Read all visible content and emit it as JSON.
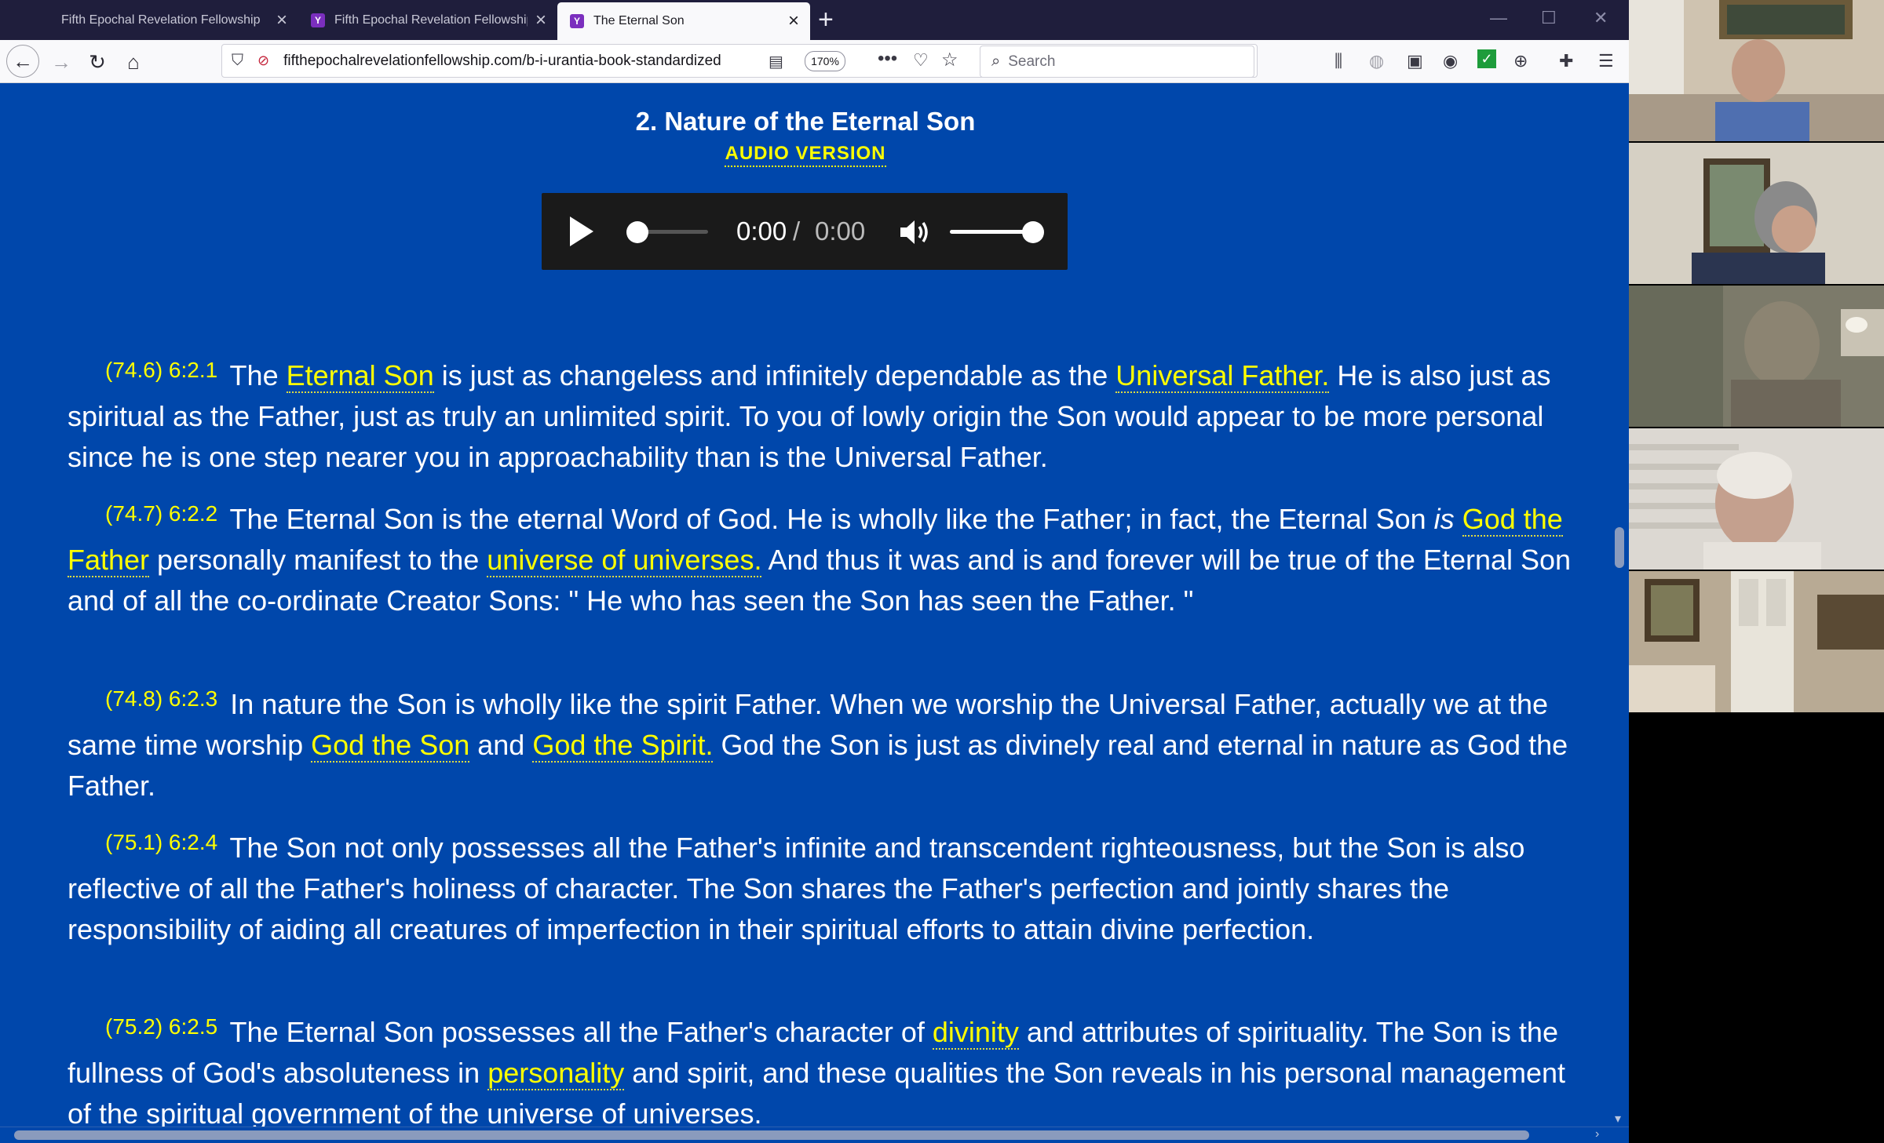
{
  "tabs": [
    {
      "title": "Fifth Epochal Revelation Fellowship",
      "active": false
    },
    {
      "title": "Fifth Epochal Revelation Fellowship",
      "active": false
    },
    {
      "title": "The Eternal Son",
      "active": true
    }
  ],
  "url": "fifthepochalrevelationfellowship.com/b-i-urantia-book-standardized",
  "zoom": "170%",
  "search_placeholder": "Search",
  "page": {
    "title": "2. Nature of the Eternal Son",
    "audio_link": "AUDIO VERSION",
    "player": {
      "current": "0:00",
      "separator": "/",
      "total": "0:00",
      "seek": 0.0,
      "volume": 1.0
    }
  },
  "paragraphs": [
    {
      "ref": "(74.6) 6:2.1",
      "t1": " The ",
      "l1": "Eternal Son",
      "t2": " is just as changeless and infinitely dependable as the ",
      "l2": "Universal Father.",
      "t3": " He is also just as spiritual as the Father, just as truly an unlimited spirit. To you of lowly origin the Son would appear to be more personal since he is one step nearer you in approachability than is the Universal Father."
    },
    {
      "ref": "(74.7) 6:2.2",
      "t1": " The Eternal Son is the eternal Word of God. He is wholly like the Father; in fact, the Eternal Son ",
      "it": "is",
      "t2": " ",
      "l1": "God the Father",
      "t3": " personally manifest to the ",
      "l2": "universe of universes.",
      "t4": " And thus it was and is and forever will be true of the Eternal Son and of all the co-ordinate Creator Sons: \" He who has seen the Son has seen the Father. \""
    },
    {
      "ref": "(74.8) 6:2.3",
      "t1": " In nature the Son is wholly like the spirit Father. When we worship the Universal Father, actually we at the same time worship ",
      "l1": "God the Son",
      "t2": " and ",
      "l2": "God the Spirit.",
      "t3": " God the Son is just as divinely real and eternal in nature as God the Father."
    },
    {
      "ref": "(75.1) 6:2.4",
      "t1": " The Son not only possesses all the Father's infinite and transcendent righteousness, but the Son is also reflective of all the Father's holiness of character. The Son shares the Father's perfection and jointly shares the responsibility of aiding all creatures of imperfection in their spiritual efforts to attain divine perfection."
    },
    {
      "ref": "(75.2) 6:2.5",
      "t1": " The Eternal Son possesses all the Father's character of ",
      "l1": "divinity",
      "t2": " and attributes of spirituality. The Son is the fullness of God's absoluteness in ",
      "l2": "personality",
      "t3": " and spirit, and these qualities the Son reveals in his personal management of the spiritual government of the universe of universes."
    }
  ],
  "colors": {
    "page_bg": "#0047ab",
    "link": "#ffff00",
    "tabbar": "#1f1e3c",
    "player_bg": "#1a1a1a"
  },
  "icons": [
    "back-arrow-icon",
    "forward-arrow-icon",
    "reload-icon",
    "home-icon",
    "shield-icon",
    "lock-warning-icon",
    "reader-view-icon",
    "more-icon",
    "pocket-icon",
    "star-icon",
    "search-icon",
    "library-icon",
    "sidebar-icon",
    "account-icon",
    "extension-icon",
    "menu-icon"
  ]
}
